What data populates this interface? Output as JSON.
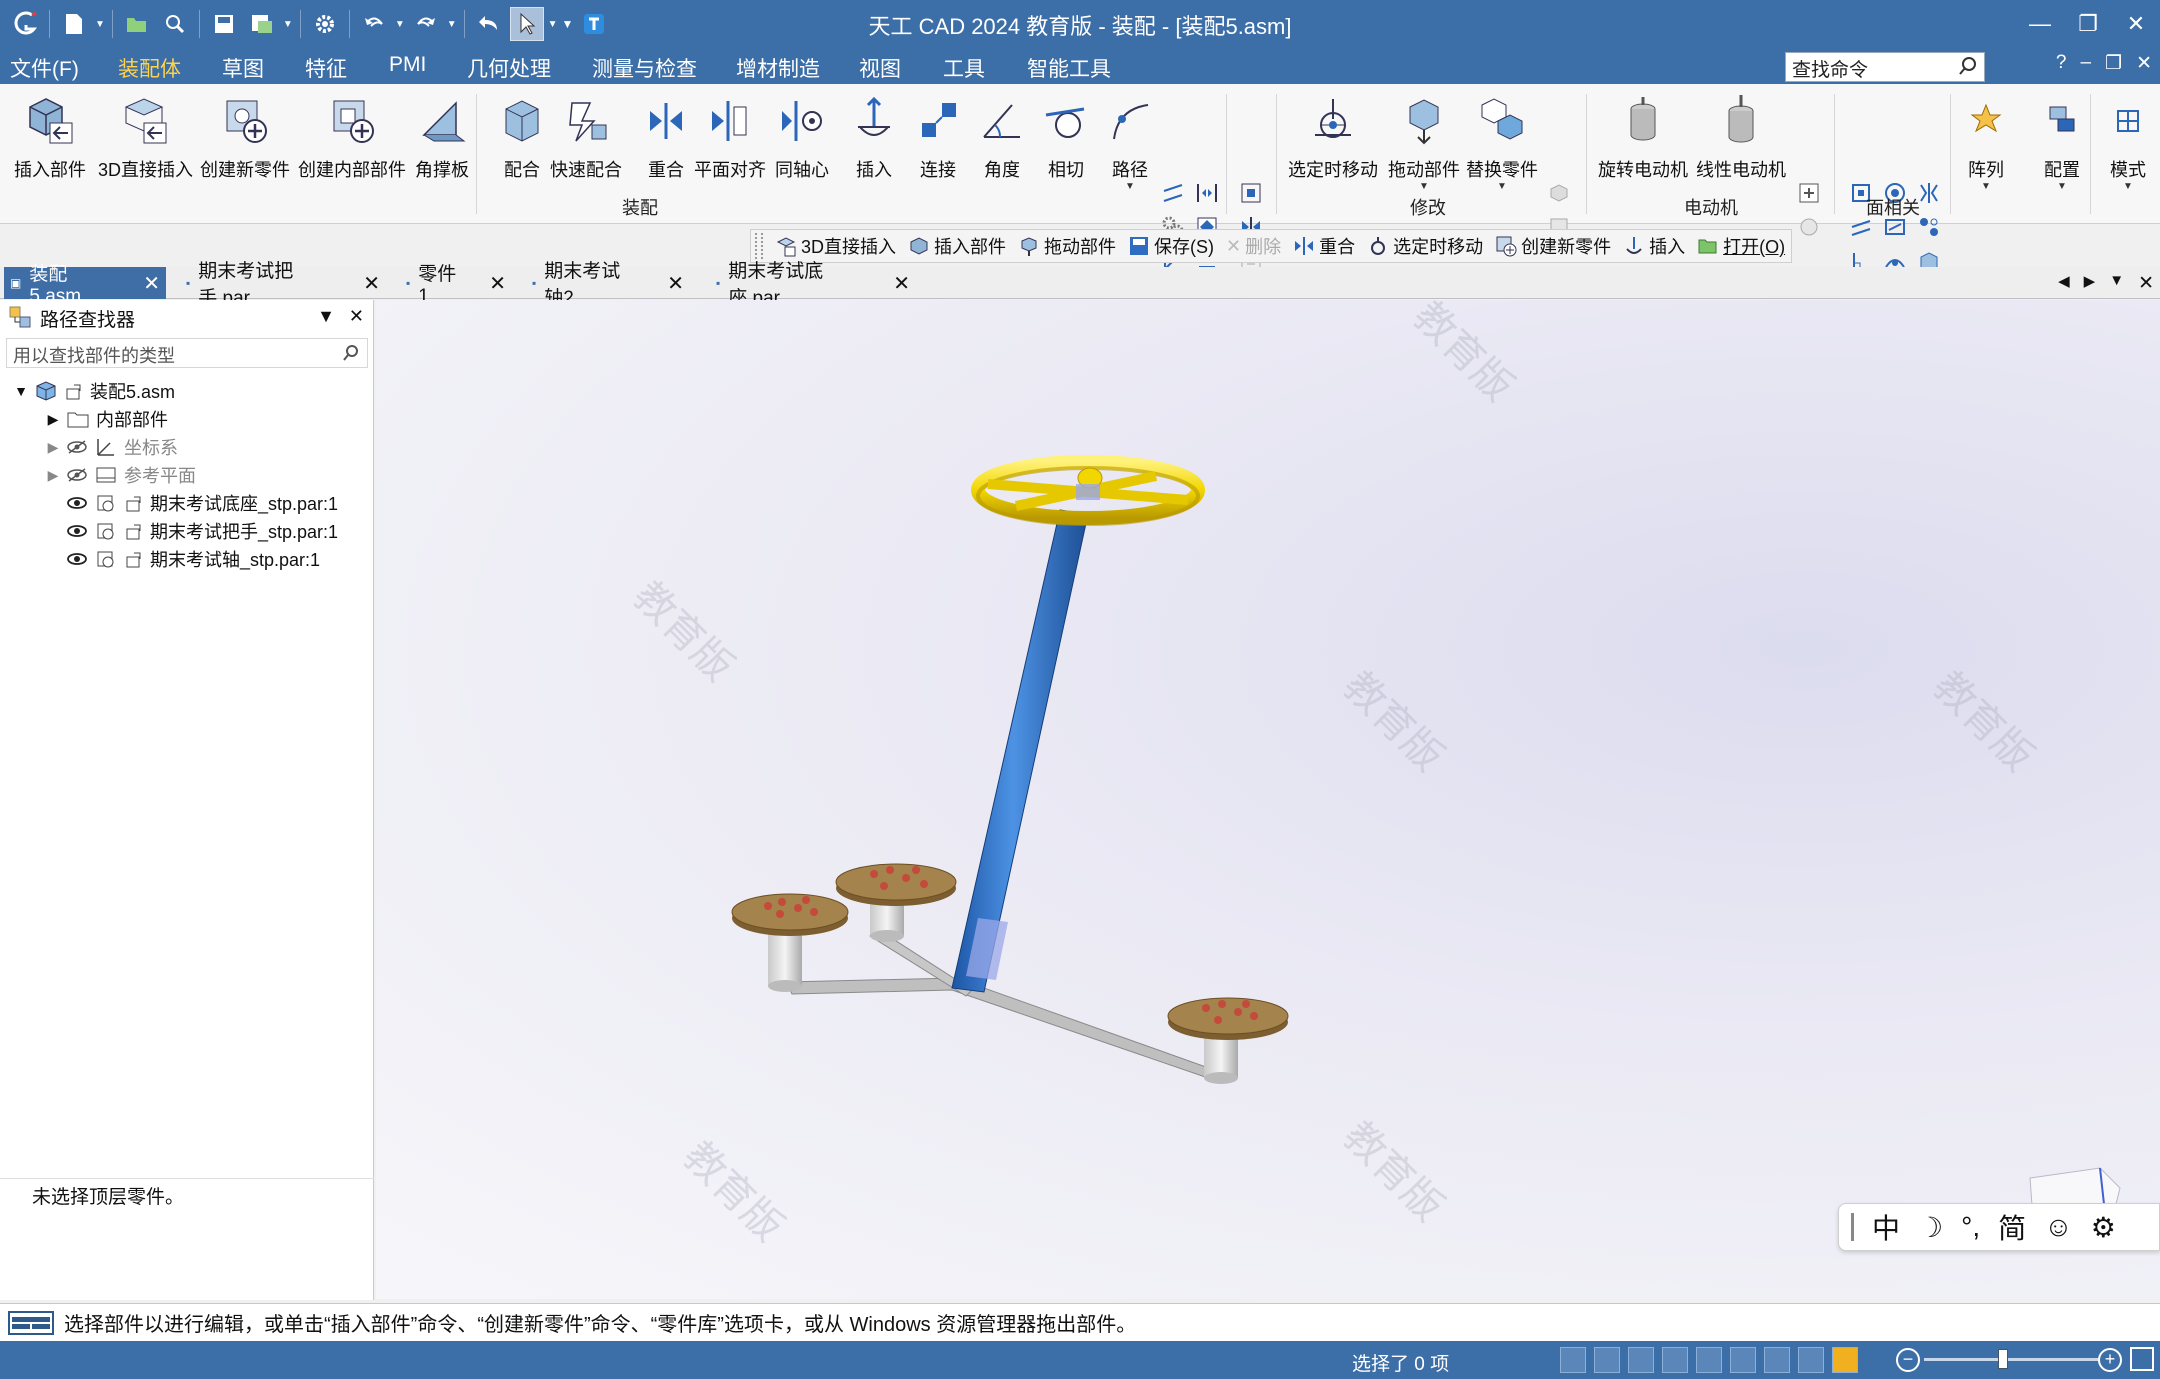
{
  "app": {
    "title": "天工 CAD 2024 教育版 - 装配 - [装配5.asm]"
  },
  "menu": {
    "items": [
      "文件(F)",
      "装配体",
      "草图",
      "特征",
      "PMI",
      "几何处理",
      "测量与检查",
      "增材制造",
      "视图",
      "工具",
      "智能工具"
    ],
    "search_placeholder": "查找命令",
    "help": "?"
  },
  "ribbon": {
    "buttons": [
      "插入部件",
      "3D直接插入",
      "创建新零件",
      "创建内部部件",
      "角撑板",
      "配合",
      "快速配合",
      "重合",
      "平面对齐",
      "同轴心",
      "插入",
      "连接",
      "角度",
      "相切",
      "路径",
      "选定时移动",
      "拖动部件",
      "替换零件",
      "旋转电动机",
      "线性电动机",
      "阵列",
      "配置",
      "模式"
    ],
    "groups": [
      "装配",
      "修改",
      "电动机",
      "面相关"
    ]
  },
  "command_bar": {
    "items": [
      "3D直接插入",
      "插入部件",
      "拖动部件",
      "保存(S)",
      "删除",
      "重合",
      "选定时移动",
      "创建新零件",
      "插入",
      "打开(O)"
    ]
  },
  "doc_tabs": [
    "装配5.asm",
    "期末考试把手.par",
    "零件1",
    "期末考试轴2",
    "期末考试底座.par"
  ],
  "pathfinder": {
    "title": "路径查找器",
    "search_placeholder": "用以查找部件的类型",
    "root": "装配5.asm",
    "nodes": [
      "内部部件",
      "坐标系",
      "参考平面"
    ],
    "parts": [
      "期末考试底座_stp.par:1",
      "期末考试把手_stp.par:1",
      "期末考试轴_stp.par:1"
    ],
    "status": "未选择顶层零件。"
  },
  "viewport": {
    "watermark": "教育版"
  },
  "ime": {
    "items": [
      "中",
      "☽",
      "°,",
      "简",
      "☺",
      "⚙"
    ]
  },
  "status": {
    "prompt": "选择部件以进行编辑，或单击“插入部件”命令、“创建新零件”命令、“零件库”选项卡，或从 Windows 资源管理器拖出部件。",
    "selection": "选择了 0 项"
  },
  "colors": {
    "accent": "#3c6ea8",
    "handwheel": "#f2d600",
    "shaft": "#3d7fd0",
    "base": "#8b6a3e"
  }
}
